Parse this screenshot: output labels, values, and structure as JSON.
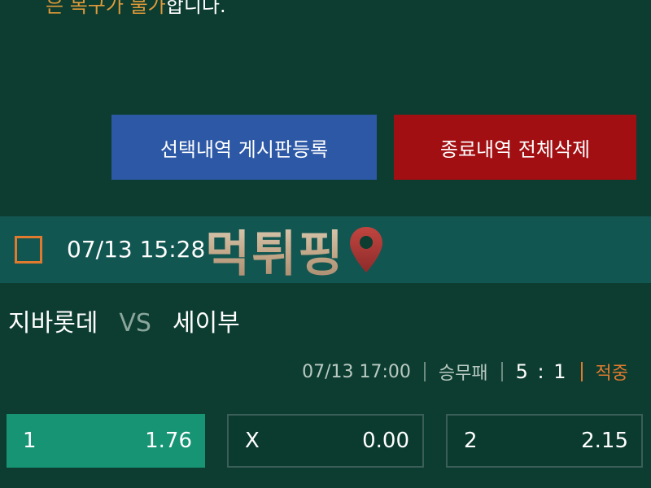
{
  "notice": {
    "highlight": "은 복구가 불가",
    "rest": "합니다."
  },
  "buttons": {
    "post_selected": "선택내역 게시판등록",
    "delete_finished": "종료내역 전체삭제"
  },
  "bet": {
    "datetime": "07/13 15:28",
    "watermark": "먹튀핑",
    "home_team": "지바롯데",
    "vs": "VS",
    "away_team": "세이부",
    "match_time": "07/13 17:00",
    "market": "승무패",
    "score": "5 : 1",
    "result": "적중",
    "odds": [
      {
        "label": "1",
        "value": "1.76",
        "selected": true
      },
      {
        "label": "X",
        "value": "0.00",
        "selected": false
      },
      {
        "label": "2",
        "value": "2.15",
        "selected": false
      }
    ]
  },
  "colors": {
    "background": "#0c3d30",
    "header_bar": "#125652",
    "blue_button": "#2d58a6",
    "red_button": "#a20f12",
    "selected_odd": "#169474",
    "accent_orange": "#e07a2e"
  },
  "icons": {
    "checkbox": "checkbox-icon",
    "watermark_pin": "map-pin-icon"
  }
}
